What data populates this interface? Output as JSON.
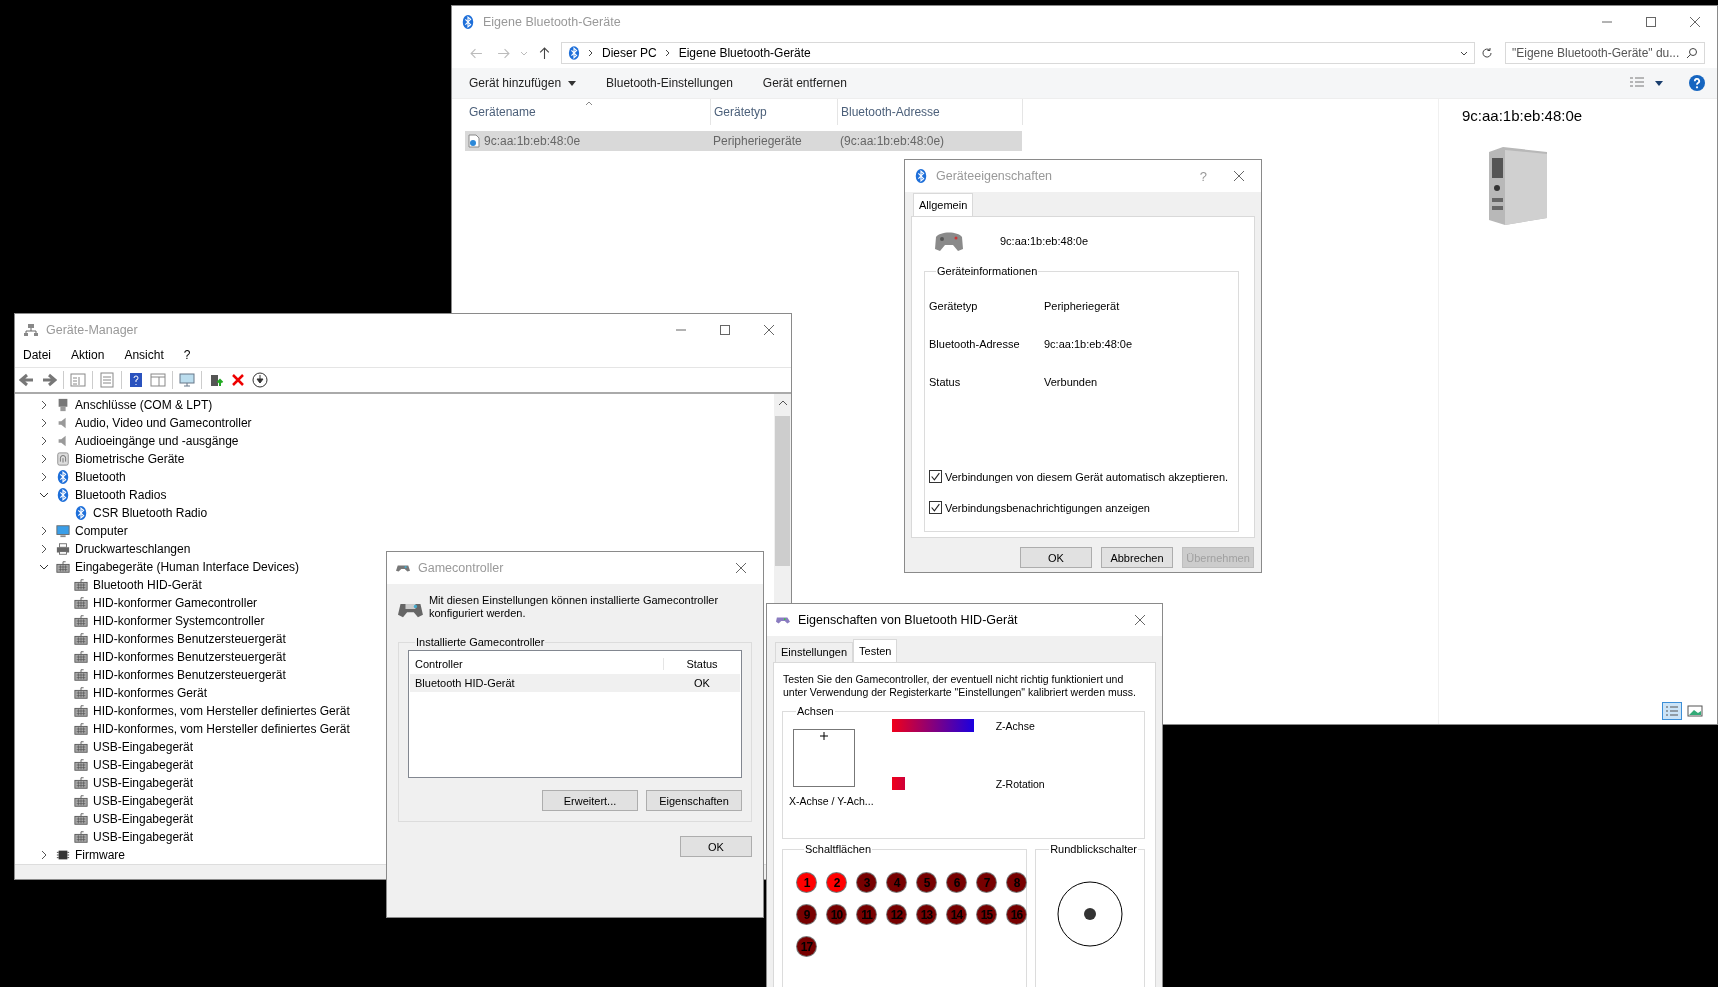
{
  "explorer": {
    "title": "Eigene Bluetooth-Geräte",
    "breadcrumb": [
      "Dieser PC",
      "Eigene Bluetooth-Geräte"
    ],
    "search": {
      "placeholder": "\"Eigene Bluetooth-Geräte\" du..."
    },
    "commands": [
      {
        "label": "Gerät hinzufügen",
        "dropdown": true
      },
      {
        "label": "Bluetooth-Einstellungen",
        "dropdown": false
      },
      {
        "label": "Gerät entfernen",
        "dropdown": false
      }
    ],
    "columns": [
      "Gerätename",
      "Gerätetyp",
      "Bluetooth-Adresse"
    ],
    "rows": [
      {
        "cells": [
          "9c:aa:1b:eb:48:0e",
          "Peripheriegeräte",
          "(9c:aa:1b:eb:48:0e)"
        ],
        "selected": true
      }
    ],
    "preview": {
      "title": "9c:aa:1b:eb:48:0e"
    },
    "view_modes": [
      {
        "kind": "details",
        "selected": true
      },
      {
        "kind": "tiles",
        "selected": false
      }
    ]
  },
  "device_manager": {
    "title": "Geräte-Manager",
    "menu": [
      "Datei",
      "Aktion",
      "Ansicht",
      "?"
    ],
    "tree": [
      {
        "label": "Anschlüsse (COM & LPT)",
        "kind": "port",
        "expanded": false
      },
      {
        "label": "Audio, Video und Gamecontroller",
        "kind": "audio",
        "expanded": false
      },
      {
        "label": "Audioeingänge und -ausgänge",
        "kind": "audio",
        "expanded": false
      },
      {
        "label": "Biometrische Geräte",
        "kind": "biometric",
        "expanded": false
      },
      {
        "label": "Bluetooth",
        "kind": "bluetooth",
        "expanded": false
      },
      {
        "label": "Bluetooth Radios",
        "kind": "bluetooth",
        "expanded": true,
        "children": [
          {
            "label": "CSR Bluetooth Radio",
            "kind": "bluetooth"
          }
        ]
      },
      {
        "label": "Computer",
        "kind": "computer",
        "expanded": false
      },
      {
        "label": "Druckwarteschlangen",
        "kind": "printer",
        "expanded": false
      },
      {
        "label": "Eingabegeräte (Human Interface Devices)",
        "kind": "hid",
        "expanded": true,
        "children": [
          {
            "label": "Bluetooth HID-Gerät",
            "kind": "hid"
          },
          {
            "label": "HID-konformer Gamecontroller",
            "kind": "hid"
          },
          {
            "label": "HID-konformer Systemcontroller",
            "kind": "hid"
          },
          {
            "label": "HID-konformes Benutzersteuergerät",
            "kind": "hid"
          },
          {
            "label": "HID-konformes Benutzersteuergerät",
            "kind": "hid"
          },
          {
            "label": "HID-konformes Benutzersteuergerät",
            "kind": "hid"
          },
          {
            "label": "HID-konformes Gerät",
            "kind": "hid"
          },
          {
            "label": "HID-konformes, vom Hersteller definiertes Gerät",
            "kind": "hid"
          },
          {
            "label": "HID-konformes, vom Hersteller definiertes Gerät",
            "kind": "hid"
          },
          {
            "label": "USB-Eingabegerät",
            "kind": "hid"
          },
          {
            "label": "USB-Eingabegerät",
            "kind": "hid"
          },
          {
            "label": "USB-Eingabegerät",
            "kind": "hid"
          },
          {
            "label": "USB-Eingabegerät",
            "kind": "hid"
          },
          {
            "label": "USB-Eingabegerät",
            "kind": "hid"
          },
          {
            "label": "USB-Eingabegerät",
            "kind": "hid"
          }
        ]
      },
      {
        "label": "Firmware",
        "kind": "firmware",
        "expanded": false
      }
    ]
  },
  "gamecontroller": {
    "title": "Gamecontroller",
    "intro": "Mit diesen Einstellungen können installierte Gamecontroller konfiguriert werden.",
    "group": "Installierte Gamecontroller",
    "columns": [
      "Controller",
      "Status"
    ],
    "rows": [
      {
        "cells": [
          "Bluetooth HID-Gerät",
          "OK"
        ],
        "selected": true
      }
    ],
    "buttons": [
      "Erweitert...",
      "Eigenschaften"
    ],
    "ok": "OK"
  },
  "device_properties": {
    "title": "Geräteeigenschaften",
    "help": "?",
    "tabs": [
      {
        "label": "Allgemein",
        "selected": true
      }
    ],
    "device_name": "9c:aa:1b:eb:48:0e",
    "group": "Geräteinformationen",
    "info": [
      {
        "label": "Gerätetyp",
        "value": "Peripheriegerät"
      },
      {
        "label": "Bluetooth-Adresse",
        "value": "9c:aa:1b:eb:48:0e"
      },
      {
        "label": "Status",
        "value": "Verbunden"
      }
    ],
    "checkboxes": [
      {
        "label": "Verbindungen von diesem Gerät automatisch akzeptieren.",
        "checked": true
      },
      {
        "label": "Verbindungsbenachrichtigungen anzeigen",
        "checked": true
      }
    ],
    "buttons": [
      {
        "label": "OK",
        "disabled": false
      },
      {
        "label": "Abbrechen",
        "disabled": false
      },
      {
        "label": "Übernehmen",
        "disabled": true
      }
    ]
  },
  "hid_properties": {
    "title": "Eigenschaften von Bluetooth HID-Gerät",
    "tabs": [
      {
        "label": "Einstellungen",
        "selected": false
      },
      {
        "label": "Testen",
        "selected": true
      }
    ],
    "intro": "Testen Sie den Gamecontroller, der eventuell nicht richtig funktioniert und unter Verwendung der Registerkarte \"Einstellungen\" kalibriert werden muss.",
    "axes": {
      "title": "Achsen",
      "xy_label": "X-Achse / Y-Ach...",
      "bars": [
        {
          "label": "Z-Achse",
          "level": 1
        },
        {
          "label": "Z-Rotation",
          "level": 0.16
        }
      ]
    },
    "buttons": {
      "title": "Schaltflächen",
      "items": [
        {
          "label": "1",
          "pressed": true
        },
        {
          "label": "2",
          "pressed": true
        },
        {
          "label": "3",
          "pressed": false
        },
        {
          "label": "4",
          "pressed": false
        },
        {
          "label": "5",
          "pressed": false
        },
        {
          "label": "6",
          "pressed": false
        },
        {
          "label": "7",
          "pressed": false
        },
        {
          "label": "8",
          "pressed": false
        },
        {
          "label": "9",
          "pressed": false
        },
        {
          "label": "10",
          "pressed": false
        },
        {
          "label": "11",
          "pressed": false
        },
        {
          "label": "12",
          "pressed": false
        },
        {
          "label": "13",
          "pressed": false
        },
        {
          "label": "14",
          "pressed": false
        },
        {
          "label": "15",
          "pressed": false
        },
        {
          "label": "16",
          "pressed": false
        },
        {
          "label": "17",
          "pressed": false
        }
      ]
    },
    "pov": {
      "title": "Rundblickschalter"
    }
  }
}
